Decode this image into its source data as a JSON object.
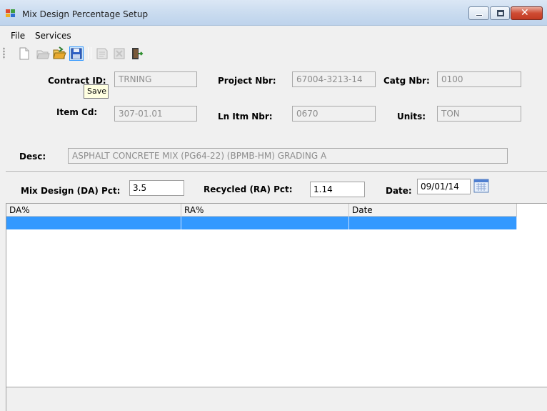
{
  "window": {
    "title": "Mix Design Percentage Setup"
  },
  "menu": {
    "file": "File",
    "services": "Services"
  },
  "toolbar": {
    "tooltip": "Save"
  },
  "form": {
    "contract_id": {
      "label": "Contract ID:",
      "value": "TRNING"
    },
    "project_nbr": {
      "label": "Project Nbr:",
      "value": "67004-3213-14"
    },
    "catg_nbr": {
      "label": "Catg Nbr:",
      "value": "0100"
    },
    "item_cd": {
      "label": "Item Cd:",
      "value": "307-01.01"
    },
    "ln_itm_nbr": {
      "label": "Ln Itm Nbr:",
      "value": "0670"
    },
    "units": {
      "label": "Units:",
      "value": "TON"
    },
    "desc": {
      "label": "Desc:",
      "value": "ASPHALT CONCRETE MIX (PG64-22) (BPMB-HM) GRADING A"
    }
  },
  "entry": {
    "mix_design": {
      "label": "Mix Design (DA) Pct:",
      "value": "3.5"
    },
    "recycled": {
      "label": "Recycled (RA) Pct:",
      "value": "1.14"
    },
    "date": {
      "label": "Date:",
      "value": "09/01/14"
    }
  },
  "grid": {
    "columns": [
      "DA%",
      "RA%",
      "Date"
    ],
    "rows": [
      [
        "",
        "",
        ""
      ]
    ]
  },
  "colors": {
    "selection": "#3399ff",
    "close_button": "#c9432b"
  }
}
